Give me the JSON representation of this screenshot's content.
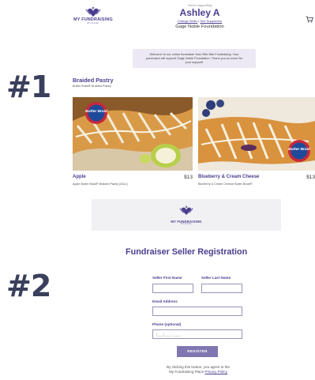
{
  "steps": {
    "one": "#1",
    "two": "#2"
  },
  "brand": {
    "name": "MY FUNDRAISING",
    "sub": "PLACE",
    "color": "#4b3e8f",
    "accent": "#8077b0"
  },
  "header": {
    "supporting_label": "You're supporting",
    "seller_name": "Ashley A",
    "change_seller": "Change Seller",
    "separator": "|",
    "see_supporters": "See Supporters",
    "organization": "Gage Noble Foundation",
    "cart_icon": "cart-icon"
  },
  "welcome": {
    "line1": "Welcome to our online fundraiser from Rite Bite Fundraising. Your",
    "line2": "purchases will support Gage Noble Foundation. Thank you so much for",
    "line3": "your support!"
  },
  "product_section": {
    "title": "Braided Pastry",
    "subtitle": "Butter Braid® Braided Pastry"
  },
  "products": [
    {
      "name": "Apple",
      "price": "$13",
      "desc": "Apple Butter Braid® Braided Pastry (22oz.)",
      "badge": "Butter Braid"
    },
    {
      "name": "Blueberry & Cream Cheese",
      "price": "$13",
      "desc": "Blueberry & Cream Cheese Butter Braid®",
      "badge": "Butter Braid"
    }
  ],
  "registration": {
    "title": "Fundraiser Seller Registration",
    "first_name_label": "Seller First Name",
    "last_name_label": "Seller Last Name",
    "email_label": "Email Address",
    "phone_label": "Phone (optional)",
    "phone_placeholder": "(___) ___-____",
    "register_button": "REGISTER",
    "disclaimer_line1": "By clicking this button, you agree to the",
    "disclaimer_line2": "My Fundraising Place",
    "privacy_link": "Privacy Policy"
  }
}
